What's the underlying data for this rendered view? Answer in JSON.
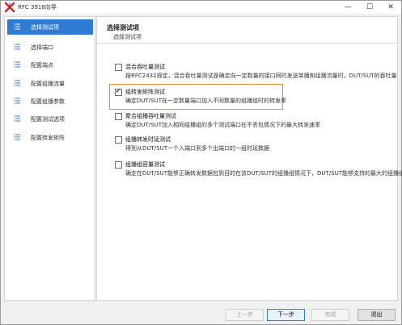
{
  "window": {
    "title": "RFC 3918向导",
    "controls": {
      "minimize": "—",
      "maximize": "☐",
      "close": "✕"
    }
  },
  "sidebar": {
    "items": [
      {
        "label": "选择测试项",
        "active": true
      },
      {
        "label": "选择端口"
      },
      {
        "label": "配置端点"
      },
      {
        "label": "配置组播流量"
      },
      {
        "label": "配置组播参数"
      },
      {
        "label": "配置测试选项"
      },
      {
        "label": "配置转发矩阵"
      }
    ]
  },
  "header": {
    "title": "选择测试项",
    "subtitle": "选择测试项"
  },
  "options": [
    {
      "title": "混合吞吐量测试",
      "desc": "按RFC2432规定，混合吞吐量测试是确定向一定数量的接口同时发送单播和组播流量时，DUT/SUT的吞吐量",
      "checked": false
    },
    {
      "title": "组转发矩阵测试",
      "desc": "确定DUT/SUT在一定数量端口加入不同数量的组播组时的转发率",
      "checked": true
    },
    {
      "title": "聚合组播吞吐量测试",
      "desc": "确定DUT/SUT加入相同组播组的多个测试端口在不丢包情况下的最大转发速率",
      "checked": false
    },
    {
      "title": "组播转发时延测试",
      "desc": "得到从DUT/SUT一个入端口到多个出端口的一组时延数据",
      "checked": false
    },
    {
      "title": "组播组容量测试",
      "desc": "确定在DUT/SUT能够正确转发数据包到目的在该DUT/SUT的组播组情况下，DUT/SUT能够支持的最大的组播组数目",
      "checked": false
    }
  ],
  "footer": {
    "prev": "上一步",
    "next": "下一步",
    "finish": "完成",
    "exit": "退出"
  },
  "colors": {
    "accent": "#2f7bd4",
    "highlight": "#f08a24"
  }
}
